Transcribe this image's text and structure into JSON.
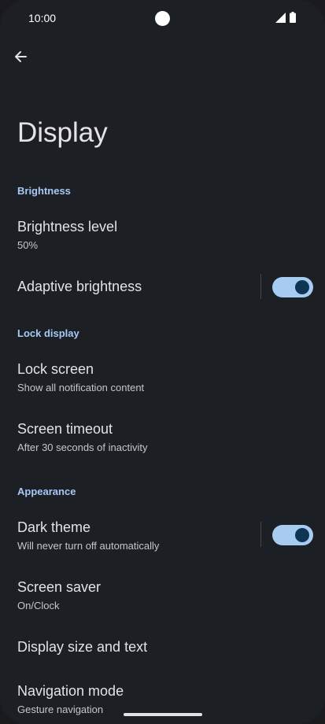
{
  "status_bar": {
    "time": "10:00",
    "icons": [
      "cellular-signal-icon",
      "battery-icon"
    ]
  },
  "header": {
    "back_icon": "arrow-left-icon",
    "title": "Display"
  },
  "sections": {
    "brightness": {
      "header": "Brightness",
      "brightness_level": {
        "title": "Brightness level",
        "subtitle": "50%"
      },
      "adaptive_brightness": {
        "title": "Adaptive brightness",
        "enabled": true
      }
    },
    "lock_display": {
      "header": "Lock display",
      "lock_screen": {
        "title": "Lock screen",
        "subtitle": "Show all notification content"
      },
      "screen_timeout": {
        "title": "Screen timeout",
        "subtitle": "After 30 seconds of inactivity"
      }
    },
    "appearance": {
      "header": "Appearance",
      "dark_theme": {
        "title": "Dark theme",
        "subtitle": "Will never turn off automatically",
        "enabled": true
      },
      "screen_saver": {
        "title": "Screen saver",
        "subtitle": "On/Clock"
      },
      "display_size": {
        "title": "Display size and text"
      },
      "navigation_mode": {
        "title": "Navigation mode",
        "subtitle": "Gesture navigation"
      }
    }
  },
  "colors": {
    "background": "#1c2024",
    "accent": "#a8c8f5",
    "switch_track": "#a8cbf2",
    "switch_thumb": "#0e3554"
  }
}
